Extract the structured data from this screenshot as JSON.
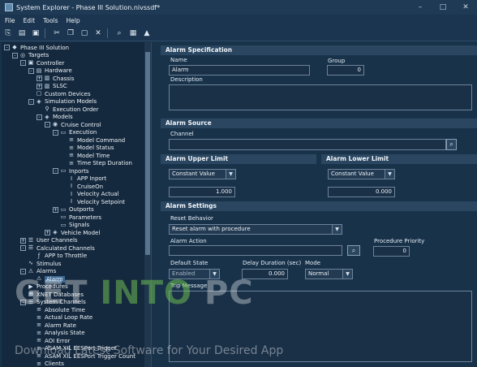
{
  "window": {
    "title": "System Explorer - Phase III Solution.nivssdf*",
    "controls": [
      "–",
      "□",
      "✕"
    ]
  },
  "menu": [
    "File",
    "Edit",
    "Tools",
    "Help"
  ],
  "tree": [
    {
      "label": "Phase III Solution",
      "lv": 0,
      "exp": "-",
      "icon": "solution-icon"
    },
    {
      "label": "Targets",
      "lv": 1,
      "exp": "-",
      "icon": "targets-icon"
    },
    {
      "label": "Controller",
      "lv": 2,
      "exp": "-",
      "icon": "controller-icon"
    },
    {
      "label": "Hardware",
      "lv": 3,
      "exp": "-",
      "icon": "hardware-icon"
    },
    {
      "label": "Chassis",
      "lv": 4,
      "exp": "+",
      "icon": "chassis-icon"
    },
    {
      "label": "SLSC",
      "lv": 4,
      "exp": "+",
      "icon": "slsc-icon"
    },
    {
      "label": "Custom Devices",
      "lv": 3,
      "exp": "",
      "icon": "device-icon"
    },
    {
      "label": "Simulation Models",
      "lv": 3,
      "exp": "-",
      "icon": "models-icon"
    },
    {
      "label": "Execution Order",
      "lv": 4,
      "exp": "",
      "icon": "order-icon"
    },
    {
      "label": "Models",
      "lv": 4,
      "exp": "-",
      "icon": "model-icon"
    },
    {
      "label": "Cruise Control",
      "lv": 5,
      "exp": "-",
      "icon": "cruise-icon"
    },
    {
      "label": "Execution",
      "lv": 6,
      "exp": "-",
      "icon": "folder-icon"
    },
    {
      "label": "Model Command",
      "lv": 7,
      "exp": "",
      "icon": "channel-icon"
    },
    {
      "label": "Model Status",
      "lv": 7,
      "exp": "",
      "icon": "channel-icon"
    },
    {
      "label": "Model Time",
      "lv": 7,
      "exp": "",
      "icon": "channel-icon"
    },
    {
      "label": "Time Step Duration",
      "lv": 7,
      "exp": "",
      "icon": "channel-icon"
    },
    {
      "label": "Inports",
      "lv": 6,
      "exp": "-",
      "icon": "folder-icon"
    },
    {
      "label": "APP Inport",
      "lv": 7,
      "exp": "",
      "icon": "inport-icon"
    },
    {
      "label": "CruiseOn",
      "lv": 7,
      "exp": "",
      "icon": "inport-icon"
    },
    {
      "label": "Velocity Actual",
      "lv": 7,
      "exp": "",
      "icon": "inport-icon"
    },
    {
      "label": "Velocity Setpoint",
      "lv": 7,
      "exp": "",
      "icon": "inport-icon"
    },
    {
      "label": "Outports",
      "lv": 6,
      "exp": "+",
      "icon": "folder-icon"
    },
    {
      "label": "Parameters",
      "lv": 6,
      "exp": "",
      "icon": "folder-icon"
    },
    {
      "label": "Signals",
      "lv": 6,
      "exp": "",
      "icon": "folder-icon"
    },
    {
      "label": "Vehicle Model",
      "lv": 5,
      "exp": "+",
      "icon": "model-icon"
    },
    {
      "label": "User Channels",
      "lv": 2,
      "exp": "+",
      "icon": "channels-icon"
    },
    {
      "label": "Calculated Channels",
      "lv": 2,
      "exp": "-",
      "icon": "calc-icon"
    },
    {
      "label": "APP to Throttle",
      "lv": 3,
      "exp": "",
      "icon": "calc-channel-icon"
    },
    {
      "label": "Stimulus",
      "lv": 2,
      "exp": "",
      "icon": "stimulus-icon"
    },
    {
      "label": "Alarms",
      "lv": 2,
      "exp": "-",
      "icon": "alarm-icon"
    },
    {
      "label": "Alarm",
      "lv": 3,
      "exp": "",
      "icon": "alarm-icon",
      "selected": true
    },
    {
      "label": "Procedures",
      "lv": 2,
      "exp": "",
      "icon": "procedure-icon"
    },
    {
      "label": "XNET Databases",
      "lv": 2,
      "exp": "",
      "icon": "database-icon"
    },
    {
      "label": "System Channels",
      "lv": 2,
      "exp": "-",
      "icon": "system-icon"
    },
    {
      "label": "Absolute Time",
      "lv": 3,
      "exp": "",
      "icon": "channel-icon"
    },
    {
      "label": "Actual Loop Rate",
      "lv": 3,
      "exp": "",
      "icon": "channel-icon"
    },
    {
      "label": "Alarm Rate",
      "lv": 3,
      "exp": "",
      "icon": "channel-icon"
    },
    {
      "label": "Analysis State",
      "lv": 3,
      "exp": "",
      "icon": "channel-icon"
    },
    {
      "label": "AOI Error",
      "lv": 3,
      "exp": "",
      "icon": "channel-icon"
    },
    {
      "label": "ASAM XIL EESPort Trigger",
      "lv": 3,
      "exp": "",
      "icon": "channel-icon"
    },
    {
      "label": "ASAM XIL EESPort Trigger Count",
      "lv": 3,
      "exp": "",
      "icon": "channel-icon"
    },
    {
      "label": "Clients",
      "lv": 3,
      "exp": "",
      "icon": "channel-icon"
    }
  ],
  "spec": {
    "header": "Alarm Specification",
    "name_label": "Name",
    "name_value": "Alarm",
    "group_label": "Group",
    "group_value": "0",
    "desc_label": "Description"
  },
  "source": {
    "header": "Alarm Source",
    "channel_label": "Channel"
  },
  "upper": {
    "header": "Alarm Upper Limit",
    "mode": "Constant Value",
    "value": "1.000"
  },
  "lower": {
    "header": "Alarm Lower Limit",
    "mode": "Constant Value",
    "value": "0.000"
  },
  "settings": {
    "header": "Alarm Settings",
    "reset_label": "Reset Behavior",
    "reset_value": "Reset alarm with procedure",
    "action_label": "Alarm Action",
    "priority_label": "Procedure Priority",
    "priority_value": "0",
    "default_label": "Default State",
    "default_value": "Enabled",
    "delay_label": "Delay Duration (sec)",
    "delay_value": "0.000",
    "mode_label": "Mode",
    "mode_value": "Normal",
    "trip_label": "Trip Message"
  },
  "watermark": {
    "a": "GET",
    "b": "INTO",
    "c": "PC",
    "sub": "Download Latest Software for Your Desired App"
  }
}
